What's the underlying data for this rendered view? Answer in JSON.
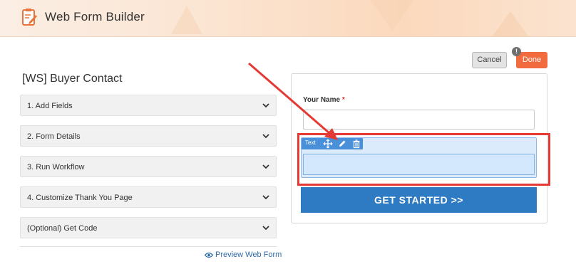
{
  "header": {
    "title": "Web Form Builder",
    "logo_icon": "form-edit-icon"
  },
  "actions": {
    "cancel_label": "Cancel",
    "done_label": "Done",
    "notice_badge": "!"
  },
  "form": {
    "name": "[WS] Buyer Contact"
  },
  "steps": [
    {
      "label": "1. Add Fields"
    },
    {
      "label": "2. Form Details"
    },
    {
      "label": "3. Run Workflow"
    },
    {
      "label": "4. Customize Thank You Page"
    },
    {
      "label": "(Optional) Get Code"
    }
  ],
  "preview_link": {
    "label": "Preview Web Form",
    "icon": "eye-icon"
  },
  "preview": {
    "fields": [
      {
        "label": "Your Name",
        "required_marker": "*",
        "value": ""
      }
    ],
    "selected_field": {
      "type_label": "Text",
      "tools": [
        "move-icon",
        "pencil-icon",
        "trash-icon"
      ],
      "value": ""
    },
    "submit_label": "GET STARTED >>"
  },
  "colors": {
    "accent_done": "#f26b3f",
    "submit_blue": "#2e7bc4",
    "annotation_red": "#e53935",
    "link_blue": "#2c6aa6"
  }
}
